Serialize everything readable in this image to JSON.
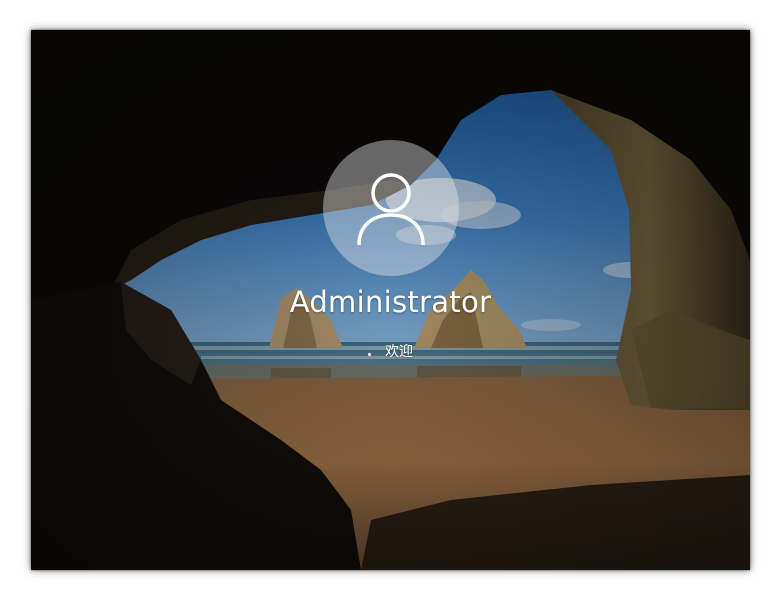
{
  "login": {
    "username": "Administrator",
    "status_text": "欢迎"
  },
  "icons": {
    "avatar": "user-silhouette-icon",
    "spinner": "loading-spinner-icon"
  },
  "colors": {
    "text": "#ffffff",
    "avatar_circle": "#ebebeb",
    "sky": "#2a6fb8",
    "sand": "#a07548",
    "cave_rock": "#2a2018"
  }
}
